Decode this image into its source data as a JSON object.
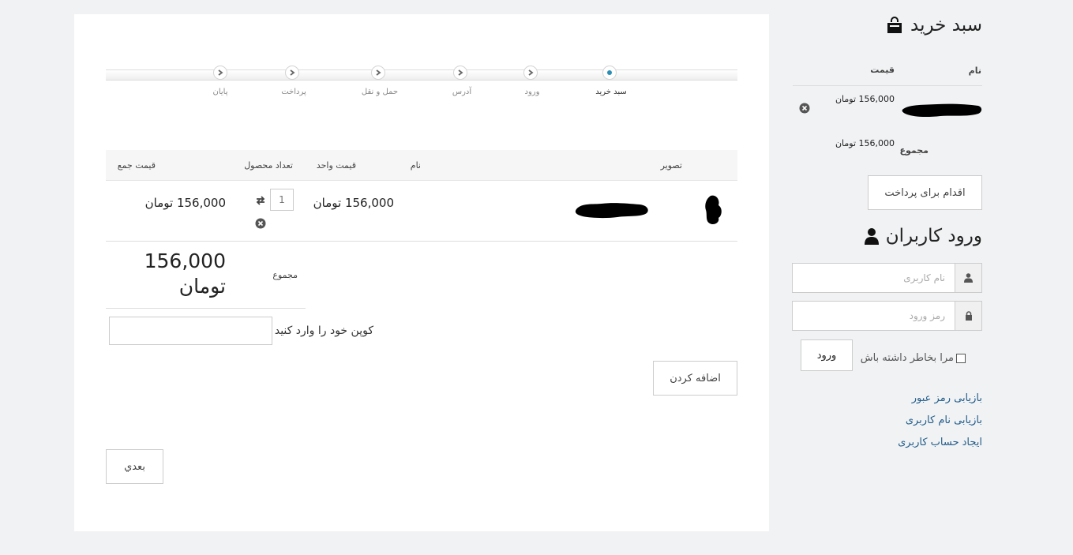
{
  "steps": [
    {
      "label": "سبد خرید",
      "active": true
    },
    {
      "label": "ورود",
      "active": false
    },
    {
      "label": "آدرس",
      "active": false
    },
    {
      "label": "حمل و نقل",
      "active": false
    },
    {
      "label": "پرداخت",
      "active": false
    },
    {
      "label": "پایان",
      "active": false
    }
  ],
  "cart_table": {
    "headers": {
      "image": "تصویر",
      "name": "نام",
      "unit_price": "قیمت واحد",
      "quantity": "تعداد محصول",
      "total_price": "قیمت جمع"
    },
    "row": {
      "quantity": "1",
      "unit_price": "156,000 تومان",
      "total_price": "156,000 تومان"
    },
    "summary_label": "مجموع",
    "summary_amount": "156,000",
    "summary_currency": "تومان"
  },
  "coupon": {
    "label": "کوپن خود را وارد کنید",
    "value": "",
    "add_button": "اضافه کردن"
  },
  "next_button": "بعدي",
  "sidebar": {
    "cart_title": "سبد خرید",
    "headers": {
      "name": "نام",
      "price": "قیمت"
    },
    "item_price": "156,000 تومان",
    "total_label": "مجموع",
    "total_price": "156,000 تومان",
    "checkout_button": "اقدام برای پرداخت",
    "login_title": "ورود کاربران",
    "username_placeholder": "نام کاربری",
    "password_placeholder": "رمز ورود",
    "remember_label": "مرا بخاطر داشته باش",
    "login_button": "ورود",
    "links": {
      "forgot_password": "بازیابی رمز عبور",
      "forgot_username": "بازیابی نام کاربری",
      "register": "ایجاد حساب کاربری"
    }
  },
  "colors": {
    "background": "#f1f2f4",
    "panel": "#ffffff",
    "active_step": "#2a8fb5",
    "link": "#225d8a"
  }
}
